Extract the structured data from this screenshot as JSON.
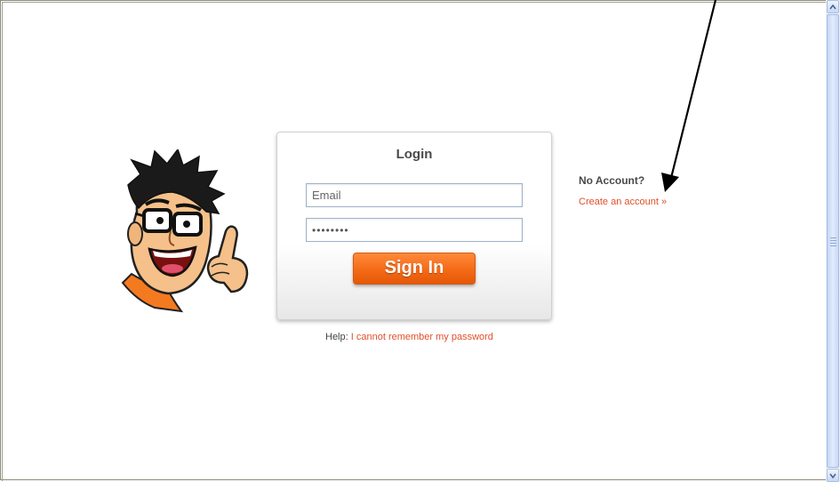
{
  "login": {
    "title": "Login",
    "email_placeholder": "Email",
    "password_value": "••••••••",
    "signin_label": "Sign In"
  },
  "help": {
    "prefix": "Help:",
    "link": "I cannot remember my password"
  },
  "signup": {
    "heading": "No Account?",
    "link": "Create an account »"
  },
  "icons": {
    "mascot": "cartoon-mascot-pointing",
    "annotation": "black-arrow-pointing-to-create-account",
    "scroll_up": "chevron-up-icon",
    "scroll_down": "chevron-down-icon"
  },
  "colors": {
    "accent": "#f46a16",
    "link": "#e0502a",
    "heading": "#4a4a4a"
  }
}
